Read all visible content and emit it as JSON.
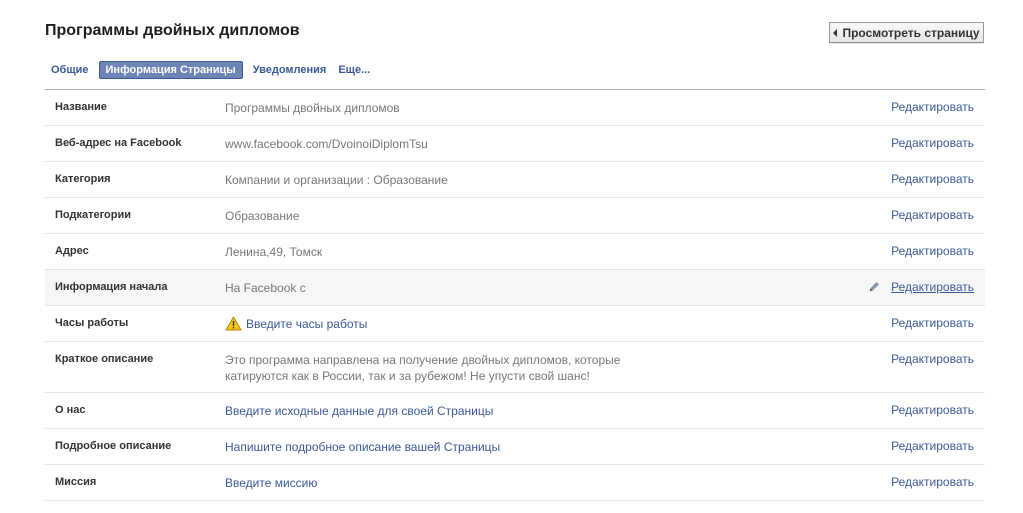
{
  "header": {
    "title": "Программы двойных дипломов",
    "view_page_label": "Просмотреть страницу"
  },
  "tabs": [
    {
      "label": "Общие"
    },
    {
      "label": "Информация Страницы",
      "active": true
    },
    {
      "label": "Уведомления"
    },
    {
      "label": "Еще..."
    }
  ],
  "colors": {
    "link": "#3b5998",
    "active_tab_bg": "#6d84b4",
    "warning": "#f5c518"
  },
  "rows": [
    {
      "label": "Название",
      "value": "Программы двойных дипломов",
      "edit": "Редактировать"
    },
    {
      "label": "Веб-адрес на Facebook",
      "value": "www.facebook.com/DvoinoiDiplomTsu",
      "edit": "Редактировать"
    },
    {
      "label": "Категория",
      "value": "Компании и организации : Образование",
      "edit": "Редактировать"
    },
    {
      "label": "Подкатегории",
      "value": "Образование",
      "edit": "Редактировать"
    },
    {
      "label": "Адрес",
      "value": "Ленина,49, Томск",
      "edit": "Редактировать"
    },
    {
      "label": "Информация начала",
      "value": "На Facebook с",
      "edit": "Редактировать",
      "highlighted": true
    },
    {
      "label": "Часы работы",
      "value": "Введите часы работы",
      "edit": "Редактировать",
      "icon": "warning-icon"
    },
    {
      "label": "Краткое описание",
      "value": "Это программа направлена на получение двойных дипломов, которые катируются как в России, так и за рубежом! Не упусти свой шанс!",
      "edit": "Редактировать"
    },
    {
      "label": "О нас",
      "value": "Введите исходные данные для своей Страницы",
      "edit": "Редактировать"
    },
    {
      "label": "Подробное описание",
      "value": "Напишите подробное описание вашей Страницы",
      "edit": "Редактировать"
    },
    {
      "label": "Миссия",
      "value": "Введите миссию",
      "edit": "Редактировать"
    }
  ]
}
